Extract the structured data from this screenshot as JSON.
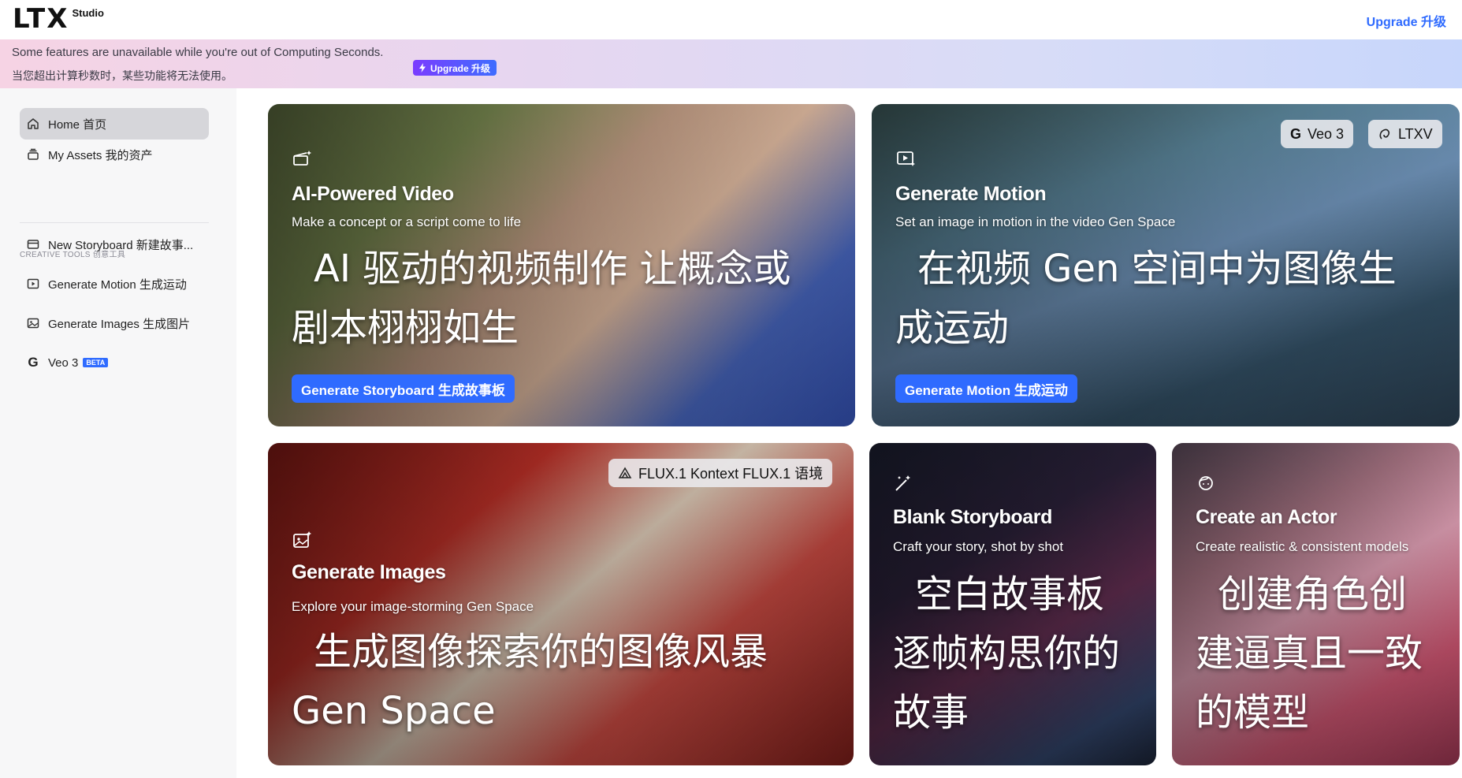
{
  "header": {
    "logo_text": "LTX",
    "logo_sub": "Studio",
    "upgrade_label": "Upgrade 升级"
  },
  "banner": {
    "line1": "Some features are unavailable while you're out of Computing Seconds.",
    "line2": "当您超出计算秒数时，某些功能将无法使用。",
    "upgrade_label": "Upgrade 升级"
  },
  "sidebar": {
    "items": [
      {
        "label": "Home 首页",
        "icon": "home-icon",
        "active": true
      },
      {
        "label": "My Assets 我的资产",
        "icon": "assets-icon",
        "active": false
      }
    ],
    "section_label": "CREATIVE TOOLS 创意工具",
    "tools": [
      {
        "label": "New Storyboard 新建故事...",
        "icon": "storyboard-icon"
      },
      {
        "label": "Generate Motion 生成运动",
        "icon": "motion-icon"
      },
      {
        "label": "Generate Images 生成图片",
        "icon": "images-icon"
      },
      {
        "label": "Veo 3",
        "icon": "google-icon",
        "badge": "BETA"
      }
    ]
  },
  "cards": {
    "ai_video": {
      "title": "AI-Powered Video",
      "subtitle": "Make a concept or a script come to life",
      "translation": "AI 驱动的视频制作 让概念或剧本栩栩如生",
      "button": "Generate Storyboard 生成故事板"
    },
    "motion": {
      "title": "Generate Motion",
      "subtitle": "Set an image in motion in the video Gen Space",
      "translation": "在视频 Gen 空间中为图像生成运动",
      "button": "Generate Motion 生成运动",
      "chips": [
        "Veo 3",
        "LTXV"
      ]
    },
    "images": {
      "title": "Generate Images",
      "subtitle": "Explore your image-storming Gen Space",
      "translation": "生成图像探索你的图像风暴 Gen Space",
      "chip": "FLUX.1 Kontext FLUX.1 语境"
    },
    "blank": {
      "title": "Blank Storyboard",
      "subtitle": "Craft your story, shot by shot",
      "translation": "空白故事板逐帧构思你的故事"
    },
    "actor": {
      "title": "Create an Actor",
      "subtitle": "Create realistic & consistent models",
      "translation": "创建角色创建逼真且一致的模型"
    }
  }
}
